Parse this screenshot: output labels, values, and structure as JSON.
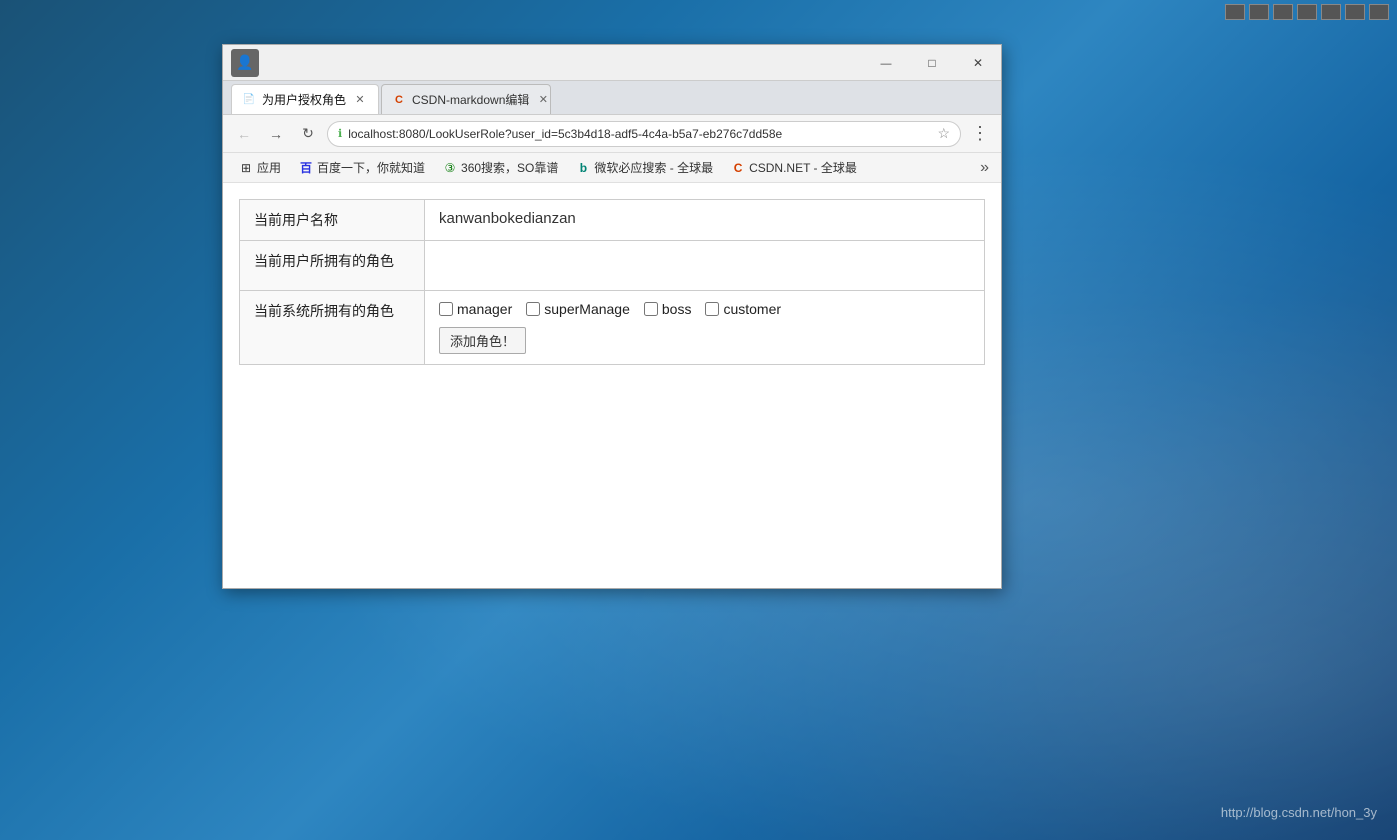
{
  "desktop": {
    "watermark": "http://blog.csdn.net/hon_3y"
  },
  "browser": {
    "title": "为用户授权角色",
    "tabs": [
      {
        "label": "为用户授权角色",
        "active": true,
        "favicon": "📄"
      },
      {
        "label": "CSDN-markdown编辑",
        "active": false,
        "favicon": "C"
      }
    ],
    "url": "localhost:8080/LookUserRole?user_id=5c3b4d18-adf5-4c4a-b5a7-eb276c7dd58e",
    "bookmarks": [
      {
        "label": "应用",
        "icon": "⊞"
      },
      {
        "label": "百度一下，你就知道",
        "icon": "百"
      },
      {
        "label": "360搜索，SO靠谱",
        "icon": "③"
      },
      {
        "label": "微软必应搜索 - 全球最",
        "icon": "b"
      },
      {
        "label": "CSDN.NET - 全球最",
        "icon": "C"
      }
    ]
  },
  "page": {
    "table": {
      "rows": [
        {
          "label": "当前用户名称",
          "value": "kanwanbokedianzan"
        },
        {
          "label": "当前用户所拥有的角色",
          "value": ""
        },
        {
          "label": "当前系统所拥有的角色",
          "roles": [
            "manager",
            "superManage",
            "boss",
            "customer"
          ],
          "button": "添加角色！"
        }
      ]
    }
  },
  "windowControls": {
    "minimize": "—",
    "maximize": "□",
    "close": "✕"
  }
}
